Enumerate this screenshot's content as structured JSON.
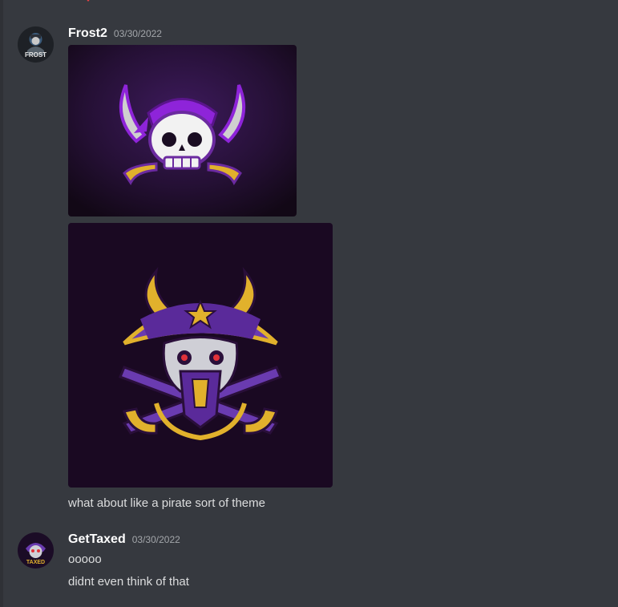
{
  "messages": [
    {
      "username": "Frost2",
      "timestamp": "03/30/2022",
      "avatar_icon": "frost-logo-avatar",
      "avatar_text": "FROST",
      "attachments": [
        "pirate-skull-bandana-logo",
        "pirate-captain-skull-logo"
      ],
      "text": "what about like a pirate sort of theme"
    },
    {
      "username": "GetTaxed",
      "timestamp": "03/30/2022",
      "avatar_icon": "taxed-logo-avatar",
      "avatar_text": "TAXED",
      "lines": [
        "ooooo",
        "didnt even think of that"
      ]
    }
  ],
  "colors": {
    "background": "#36393f",
    "username": "#ffffff",
    "timestamp": "#a3a6aa",
    "message_text": "#dcddde",
    "purple_accent": "#8e24d9",
    "gold_accent": "#e1b12c"
  }
}
